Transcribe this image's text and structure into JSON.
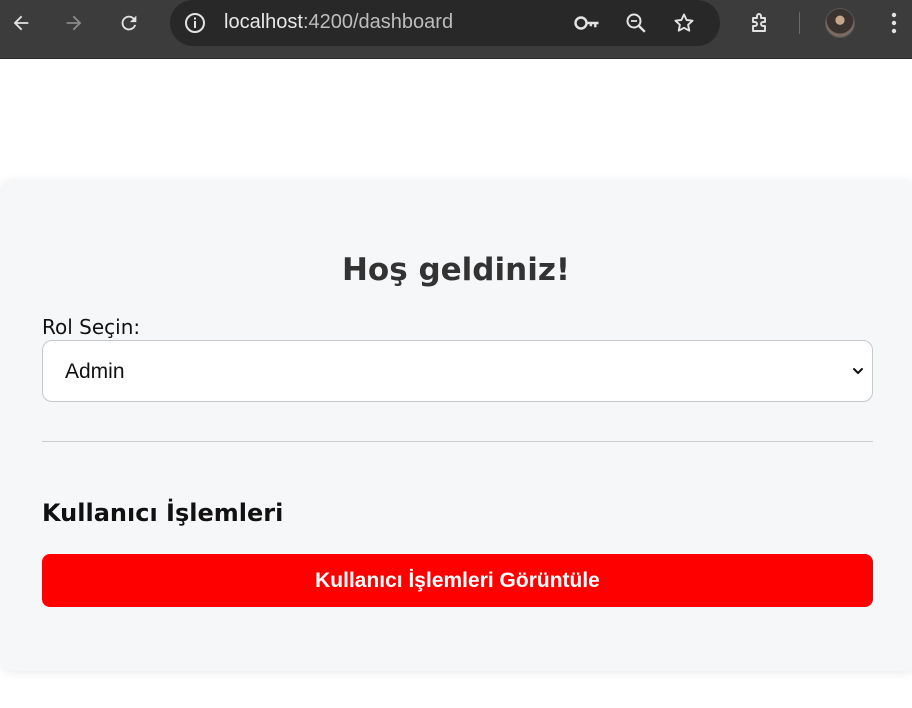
{
  "browser": {
    "url_host": "localhost",
    "url_path": ":4200/dashboard",
    "icons": [
      "back-icon",
      "forward-icon",
      "reload-icon",
      "site-info-icon",
      "password-key-icon",
      "zoom-icon",
      "bookmark-star-icon",
      "extensions-icon",
      "profile-avatar",
      "menu-icon"
    ]
  },
  "page": {
    "title": "Hoş geldiniz!",
    "role_label": "Rol Seçin:",
    "role_select": {
      "selected": "Admin"
    },
    "section_title": "Kullanıcı İşlemleri",
    "action_button": "Kullanıcı İşlemleri Görüntüle"
  },
  "colors": {
    "toolbar": "#3c3c3c",
    "omnibox": "#282828",
    "card_bg": "#f6f7f9",
    "button": "#ff0000",
    "button_text": "#ffffff"
  }
}
